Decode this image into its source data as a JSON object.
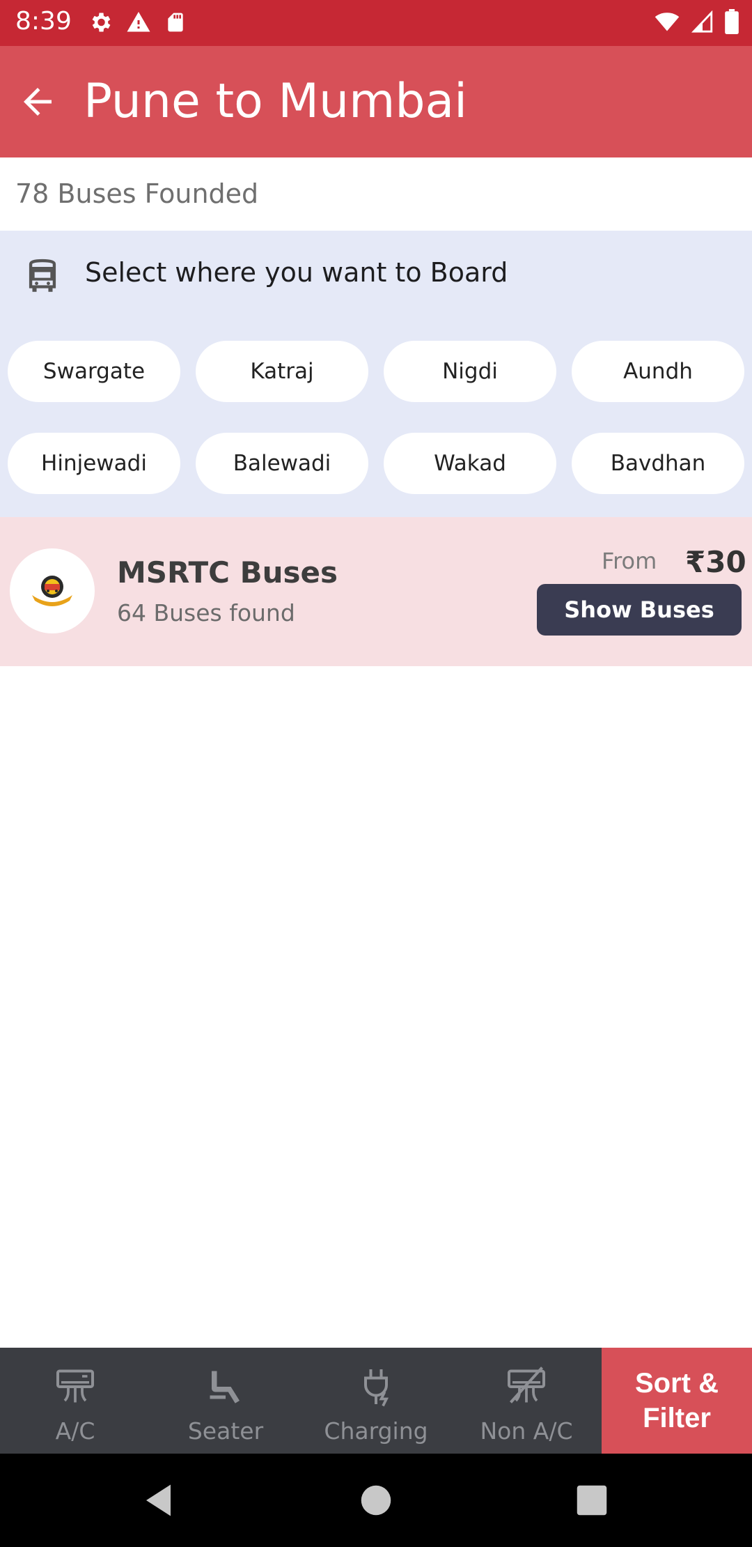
{
  "status_bar": {
    "time": "8:39",
    "left_icons": [
      "gear-icon",
      "warning-icon",
      "sd-card-icon"
    ],
    "right_icons": [
      "wifi-icon",
      "signal-icon",
      "battery-icon"
    ],
    "background": "#c62834"
  },
  "app_bar": {
    "title": "Pune to Mumbai",
    "back_icon": "back-arrow-icon",
    "background": "#d75058"
  },
  "results": {
    "count_text": "78 Buses Founded"
  },
  "boarding": {
    "title": "Select where you want to Board",
    "icon": "bus-icon",
    "background": "#e5e9f7",
    "points": [
      "Swargate",
      "Katraj",
      "Nigdi",
      "Aundh",
      "Hinjewadi",
      "Balewadi",
      "Wakad",
      "Bavdhan"
    ]
  },
  "operator": {
    "name": "MSRTC Buses",
    "count_text": "64 Buses found",
    "from_label": "From",
    "price": "₹30",
    "button_label": "Show Buses",
    "background": "#f7dfe2"
  },
  "filters": {
    "items": [
      {
        "label": "A/C",
        "icon": "ac-icon"
      },
      {
        "label": "Seater",
        "icon": "seat-icon"
      },
      {
        "label": "Charging",
        "icon": "charging-plug-icon"
      },
      {
        "label": "Non A/C",
        "icon": "non-ac-icon"
      }
    ],
    "sort_filter_line1": "Sort &",
    "sort_filter_line2": "Filter",
    "accent": "#d75058"
  },
  "nav": {
    "icons": [
      "nav-back-icon",
      "nav-home-icon",
      "nav-recents-icon"
    ]
  }
}
